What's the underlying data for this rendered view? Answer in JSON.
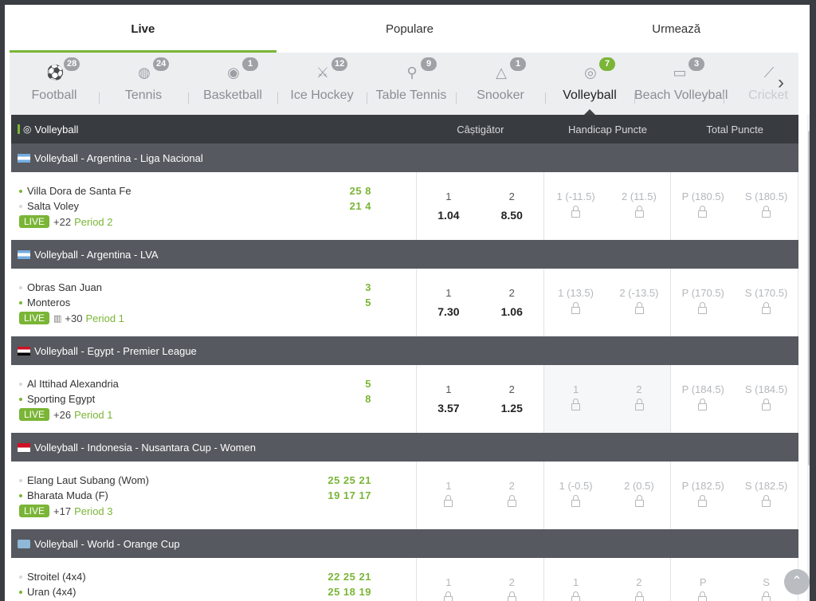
{
  "tabs": [
    {
      "label": "Live",
      "active": true
    },
    {
      "label": "Populare",
      "active": false
    },
    {
      "label": "Urmează",
      "active": false
    }
  ],
  "sports": [
    {
      "label": "Football",
      "count": "28",
      "icon": "football-icon",
      "glyph": "⚽",
      "badge": "grey"
    },
    {
      "label": "Tennis",
      "count": "24",
      "icon": "tennis-icon",
      "glyph": "◍",
      "badge": "grey"
    },
    {
      "label": "Basketball",
      "count": "1",
      "icon": "basketball-icon",
      "glyph": "◉",
      "badge": "grey"
    },
    {
      "label": "Ice Hockey",
      "count": "12",
      "icon": "ice-hockey-icon",
      "glyph": "⚔",
      "badge": "grey"
    },
    {
      "label": "Table Tennis",
      "count": "9",
      "icon": "table-tennis-icon",
      "glyph": "⚲",
      "badge": "grey"
    },
    {
      "label": "Snooker",
      "count": "1",
      "icon": "snooker-icon",
      "glyph": "△",
      "badge": "grey"
    },
    {
      "label": "Volleyball",
      "count": "7",
      "icon": "volleyball-icon",
      "glyph": "◎",
      "badge": "green",
      "active": true
    },
    {
      "label": "Beach Volleyball",
      "count": "3",
      "icon": "beach-volleyball-icon",
      "glyph": "▭",
      "badge": "grey"
    },
    {
      "label": "Cricket",
      "count": "",
      "icon": "cricket-icon",
      "glyph": "⟋",
      "badge": "none",
      "faded": true
    }
  ],
  "table_header": {
    "title": "Volleyball",
    "col_winner": "Câștigător",
    "col_handicap": "Handicap Puncte",
    "col_total": "Total Puncte"
  },
  "live_label": "LIVE",
  "colors": {
    "accent": "#7ab536",
    "header_dark": "#383b40",
    "league_bar": "#56595f"
  },
  "leagues": [
    {
      "name": "Volleyball - Argentina - Liga Nacional",
      "flag": "ar",
      "home": "Villa Dora de Santa Fe",
      "away": "Salta Voley",
      "home_score": "25 8",
      "away_score": "21 4",
      "home_serving": true,
      "away_serving": false,
      "plus": "+22",
      "period": "Period 2",
      "stats_icon": false,
      "odds": [
        {
          "label": "1",
          "value": "1.04",
          "locked": false
        },
        {
          "label": "2",
          "value": "8.50",
          "locked": false
        },
        {
          "label": "1 (-11.5)",
          "value": "",
          "locked": true
        },
        {
          "label": "2 (11.5)",
          "value": "",
          "locked": true
        },
        {
          "label": "P (180.5)",
          "value": "",
          "locked": true
        },
        {
          "label": "S (180.5)",
          "value": "",
          "locked": true
        }
      ]
    },
    {
      "name": "Volleyball - Argentina - LVA",
      "flag": "ar",
      "home": "Obras San Juan",
      "away": "Monteros",
      "home_score": "3",
      "away_score": "5",
      "home_serving": false,
      "away_serving": true,
      "plus": "+30",
      "period": "Period 1",
      "stats_icon": true,
      "odds": [
        {
          "label": "1",
          "value": "7.30",
          "locked": false
        },
        {
          "label": "2",
          "value": "1.06",
          "locked": false
        },
        {
          "label": "1 (13.5)",
          "value": "",
          "locked": true
        },
        {
          "label": "2 (-13.5)",
          "value": "",
          "locked": true
        },
        {
          "label": "P (170.5)",
          "value": "",
          "locked": true
        },
        {
          "label": "S (170.5)",
          "value": "",
          "locked": true
        }
      ]
    },
    {
      "name": "Volleyball - Egypt - Premier League",
      "flag": "eg",
      "home": "Al Ittihad Alexandria",
      "away": "Sporting Egypt",
      "home_score": "5",
      "away_score": "8",
      "home_serving": false,
      "away_serving": true,
      "plus": "+26",
      "period": "Period 1",
      "stats_icon": false,
      "odds": [
        {
          "label": "1",
          "value": "3.57",
          "locked": false
        },
        {
          "label": "2",
          "value": "1.25",
          "locked": false
        },
        {
          "label": "1",
          "value": "",
          "locked": true,
          "shade": true
        },
        {
          "label": "2",
          "value": "",
          "locked": true,
          "shade": true
        },
        {
          "label": "P (184.5)",
          "value": "",
          "locked": true
        },
        {
          "label": "S (184.5)",
          "value": "",
          "locked": true
        }
      ]
    },
    {
      "name": "Volleyball - Indonesia - Nusantara Cup - Women",
      "flag": "id",
      "home": "Elang Laut Subang (Wom)",
      "away": "Bharata Muda (F)",
      "home_score": "25 25 21",
      "away_score": "19 17 17",
      "home_serving": false,
      "away_serving": true,
      "plus": "+17",
      "period": "Period 3",
      "stats_icon": false,
      "odds": [
        {
          "label": "1",
          "value": "",
          "locked": true
        },
        {
          "label": "2",
          "value": "",
          "locked": true
        },
        {
          "label": "1 (-0.5)",
          "value": "",
          "locked": true
        },
        {
          "label": "2 (0.5)",
          "value": "",
          "locked": true
        },
        {
          "label": "P (182.5)",
          "value": "",
          "locked": true
        },
        {
          "label": "S (182.5)",
          "value": "",
          "locked": true
        }
      ]
    },
    {
      "name": "Volleyball - World - Orange Cup",
      "flag": "wd",
      "home": "Stroitel (4x4)",
      "away": "Uran (4x4)",
      "home_score": "22 25 21",
      "away_score": "25 18 19",
      "home_serving": false,
      "away_serving": true,
      "plus": "",
      "period": "",
      "stats_icon": false,
      "odds": [
        {
          "label": "1",
          "value": "",
          "locked": true
        },
        {
          "label": "2",
          "value": "",
          "locked": true
        },
        {
          "label": "1",
          "value": "",
          "locked": true
        },
        {
          "label": "2",
          "value": "",
          "locked": true
        },
        {
          "label": "P",
          "value": "",
          "locked": true
        },
        {
          "label": "S",
          "value": "",
          "locked": true
        }
      ]
    }
  ]
}
